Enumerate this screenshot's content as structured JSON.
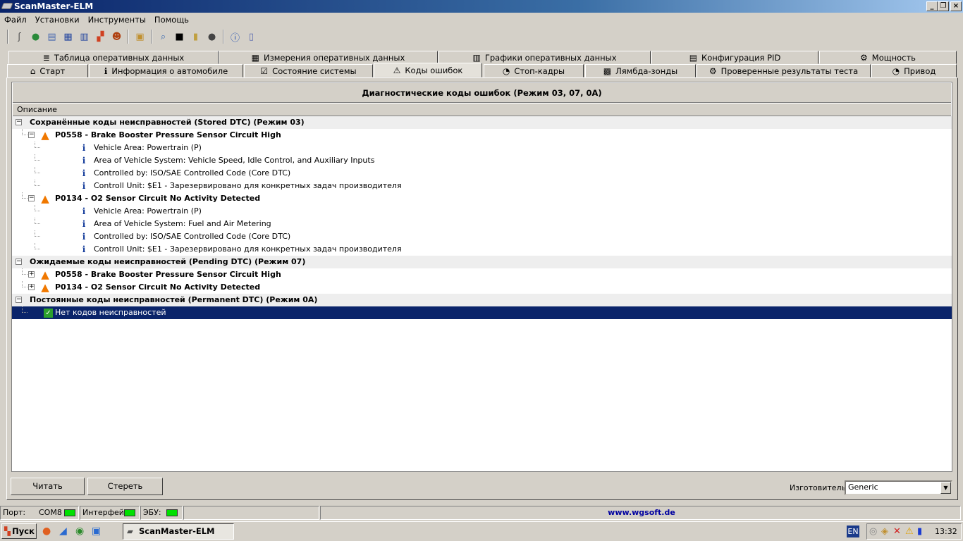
{
  "window": {
    "title": "ScanMaster-ELM"
  },
  "menu": [
    "Файл",
    "Установки",
    "Инструменты",
    "Помощь"
  ],
  "toolbar_icons": [
    "connect-icon",
    "globe-icon",
    "report-icon",
    "table-icon",
    "chart-icon",
    "map-icon",
    "user-icon",
    "clipboard-icon",
    "search-icon",
    "terminal-icon",
    "battery-icon",
    "gauge-icon",
    "info-icon",
    "exit-icon"
  ],
  "tabs_row1": [
    {
      "label": "Таблица оперативных данных",
      "icon": "≣"
    },
    {
      "label": "Измерения оперативных данных",
      "icon": "▦"
    },
    {
      "label": "Графики оперативных данных",
      "icon": "▥"
    },
    {
      "label": "Конфигурация PID",
      "icon": "▤"
    },
    {
      "label": "Мощность",
      "icon": "⚙"
    }
  ],
  "tabs_row2": [
    {
      "label": "Старт",
      "icon": "⌂"
    },
    {
      "label": "Информация о автомобиле",
      "icon": "ℹ"
    },
    {
      "label": "Состояние системы",
      "icon": "☑"
    },
    {
      "label": "Коды ошибок",
      "icon": "⚠"
    },
    {
      "label": "Стоп-кадры",
      "icon": "◔"
    },
    {
      "label": "Лямбда-зонды",
      "icon": "▩"
    },
    {
      "label": "Проверенные результаты теста",
      "icon": "⚙"
    },
    {
      "label": "Привод",
      "icon": "◔"
    }
  ],
  "panel": {
    "title": "Диагностические коды ошибок (Режим 03, 07, 0A)",
    "column": "Описание"
  },
  "tree": [
    {
      "level": 0,
      "type": "group",
      "exp": "−",
      "text": "Сохранённые коды неисправностей (Stored DTC) (Режим 03)"
    },
    {
      "level": 1,
      "type": "dtc",
      "exp": "−",
      "text": "P0558 - Brake Booster Pressure Sensor Circuit High"
    },
    {
      "level": 2,
      "type": "info",
      "text": "Vehicle Area: Powertrain (P)"
    },
    {
      "level": 2,
      "type": "info",
      "text": "Area of Vehicle System: Vehicle Speed, Idle Control, and Auxiliary Inputs"
    },
    {
      "level": 2,
      "type": "info",
      "text": "Controlled by: ISO/SAE Controlled Code (Core DTC)"
    },
    {
      "level": 2,
      "type": "info",
      "text": "Controll Unit: $E1 - Зарезервировано для конкретных задач производителя"
    },
    {
      "level": 1,
      "type": "dtc",
      "exp": "−",
      "text": "P0134 - O2 Sensor Circuit No Activity Detected"
    },
    {
      "level": 2,
      "type": "info",
      "text": "Vehicle Area: Powertrain (P)"
    },
    {
      "level": 2,
      "type": "info",
      "text": "Area of Vehicle System: Fuel and Air Metering"
    },
    {
      "level": 2,
      "type": "info",
      "text": "Controlled by: ISO/SAE Controlled Code (Core DTC)"
    },
    {
      "level": 2,
      "type": "info",
      "text": "Controll Unit: $E1 - Зарезервировано для конкретных задач производителя"
    },
    {
      "level": 0,
      "type": "group",
      "exp": "−",
      "text": "Ожидаемые коды неисправностей (Pending DTC) (Режим 07)"
    },
    {
      "level": 1,
      "type": "dtc",
      "exp": "+",
      "text": "P0558 - Brake Booster Pressure Sensor Circuit High"
    },
    {
      "level": 1,
      "type": "dtc",
      "exp": "+",
      "text": "P0134 - O2 Sensor Circuit No Activity Detected"
    },
    {
      "level": 0,
      "type": "group",
      "exp": "−",
      "text": "Постоянные коды неисправностей (Permanent DTC) (Режим 0A)"
    },
    {
      "level": 1,
      "type": "ok",
      "selected": true,
      "text": "Нет кодов неисправностей"
    }
  ],
  "buttons": {
    "read": "Читать",
    "clear": "Стереть"
  },
  "manufacturer": {
    "label": "Изготовитель",
    "value": "Generic"
  },
  "status": {
    "port_label": "Порт:",
    "port_value": "COM8",
    "interface_label": "Интерфейс:",
    "ecu_label": "ЭБУ:",
    "link": "www.wgsoft.de",
    "led_color": "#00e000"
  },
  "taskbar": {
    "start": "Пуск",
    "task": "ScanMaster-ELM",
    "lang": "EN",
    "clock": "13:32"
  }
}
